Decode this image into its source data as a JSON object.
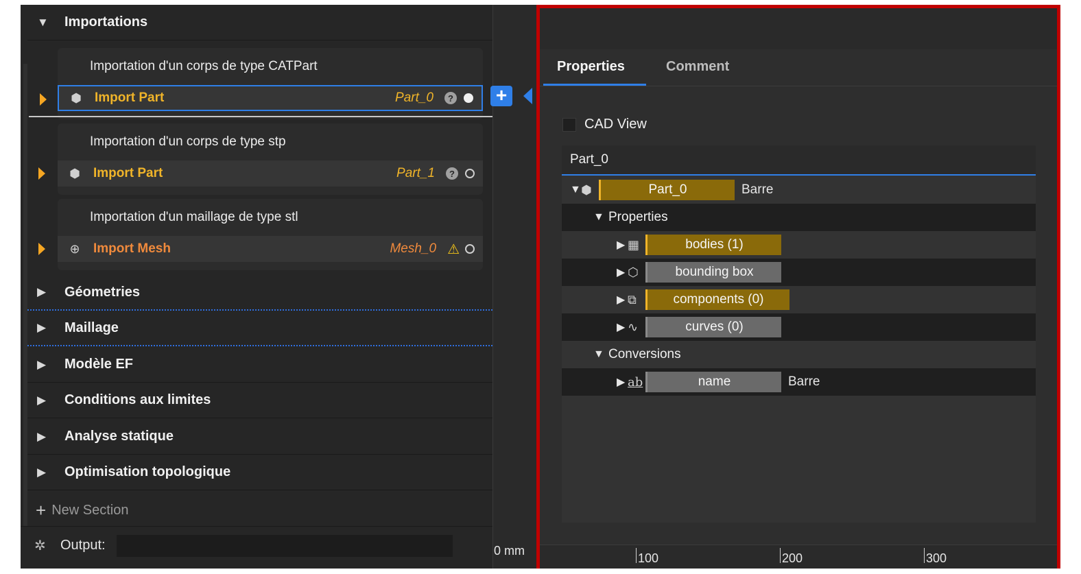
{
  "sections": {
    "importations": "Importations",
    "geometries": "Géometries",
    "maillage": "Maillage",
    "modele_ef": "Modèle EF",
    "conditions": "Conditions aux limites",
    "analyse": "Analyse statique",
    "optimisation": "Optimisation topologique",
    "new_section": "New Section"
  },
  "cards": [
    {
      "desc": "Importation d'un corps de type CATPart",
      "label": "Import Part",
      "object": "Part_0",
      "status": "filled",
      "icon": "cube-icon",
      "help": "?"
    },
    {
      "desc": "Importation d'un corps de type stp",
      "label": "Import Part",
      "object": "Part_1",
      "status": "empty",
      "icon": "cube-icon",
      "help": "?"
    },
    {
      "desc": "Importation d'un maillage de type stl",
      "label": "Import Mesh",
      "object": "Mesh_0",
      "status": "empty",
      "icon": "globe-icon",
      "warning": "⚠"
    }
  ],
  "output": {
    "label": "Output:"
  },
  "middle": {
    "add": "+",
    "ruler_zero": "0 mm"
  },
  "right": {
    "tabs": {
      "properties": "Properties",
      "comment": "Comment"
    },
    "cad_view": "CAD View",
    "tree": {
      "header": "Part_0",
      "root": {
        "name": "Part_0",
        "value": "Barre"
      },
      "properties_label": "Properties",
      "items": [
        {
          "name": "bodies (1)",
          "style": "gold"
        },
        {
          "name": "bounding box",
          "style": "grey"
        },
        {
          "name": "components (0)",
          "style": "gold"
        },
        {
          "name": "curves (0)",
          "style": "grey"
        }
      ],
      "conversions_label": "Conversions",
      "conversion_item": {
        "name": "name",
        "value": "Barre",
        "icon_text": "ab"
      }
    },
    "ruler": [
      "100",
      "200",
      "300"
    ]
  },
  "colors": {
    "accent": "#2f7fe8",
    "gold": "#8a6a0a",
    "frame": "#c00000",
    "warning": "#f5c518"
  }
}
